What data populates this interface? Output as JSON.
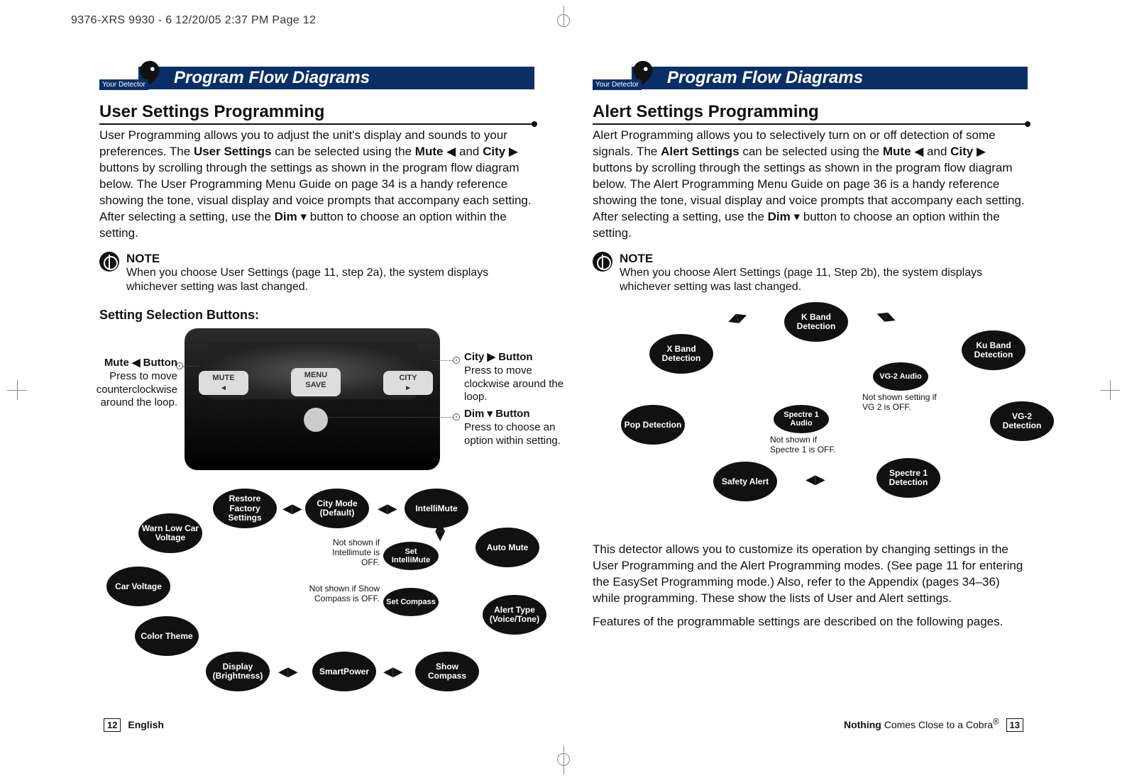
{
  "slug": "9376-XRS 9930 - 6  12/20/05  2:37 PM  Page 12",
  "header": {
    "badge_text": "Your Detector",
    "title": "Program Flow Diagrams"
  },
  "left": {
    "section_title": "User Settings Programming",
    "intro_html": "User Programming allows you to adjust the unit's display and sounds to your preferences. The <b>User Settings</b> can be selected using the <b>Mute</b> ◀ and <b>City</b> ▶ buttons by scrolling through the settings as shown in the program flow diagram below. The User Programming Menu Guide on page 34 is a handy reference showing the tone, visual display and voice prompts that accompany each setting. After selecting a setting, use the <b>Dim</b> ▾ button to choose an option within the setting.",
    "note_head": "NOTE",
    "note_body": "When you choose User Settings (page 11, step 2a), the system displays whichever setting was last changed.",
    "subhead": "Setting Selection Buttons:",
    "device_labels": {
      "mute": "MUTE",
      "menu": "MENU\nSAVE",
      "city": "CITY"
    },
    "callouts": {
      "mute": {
        "title": "Mute ◀ Button",
        "body": "Press to move counterclockwise around the loop."
      },
      "city": {
        "title": "City ▶ Button",
        "body": "Press to move clockwise around the loop."
      },
      "dim": {
        "title": "Dim ▾ Button",
        "body": "Press to choose an option within setting."
      }
    },
    "loop_nodes": [
      "City Mode (Default)",
      "IntelliMute",
      "Auto Mute",
      "Alert Type (Voice/Tone)",
      "Show Compass",
      "SmartPower",
      "Display (Brightness)",
      "Color Theme",
      "Car Voltage",
      "Warn Low Car Voltage",
      "Restore Factory Settings"
    ],
    "loop_side_nodes": [
      "Set IntelliMute",
      "Set Compass"
    ],
    "loop_hints": {
      "intellimute": "Not shown if Intellimute is OFF.",
      "compass": "Not shown if Show Compass is OFF."
    },
    "footer_page": "12",
    "footer_text": "English"
  },
  "right": {
    "section_title": "Alert Settings Programming",
    "intro_html": "Alert Programming allows you to selectively turn on or off detection of some signals. The <b>Alert Settings</b> can be selected using the <b>Mute</b> ◀ and <b>City</b> ▶ buttons by scrolling through the settings as shown in the program flow diagram below. The Alert Programming Menu Guide on page 36 is a handy reference showing the tone, visual display and voice prompts that accompany each setting. After selecting a setting, use the <b>Dim</b> ▾ button to choose an option within the setting.",
    "note_head": "NOTE",
    "note_body": "When you choose Alert Settings (page 11, Step 2b), the system displays whichever setting was last changed.",
    "loop_nodes": [
      "K Band Detection",
      "Ku Band Detection",
      "VG-2 Detection",
      "Spectre 1 Detection",
      "Safety Alert",
      "Pop Detection",
      "X Band Detection"
    ],
    "loop_side_nodes": [
      "VG-2 Audio",
      "Spectre 1 Audio"
    ],
    "loop_hints": {
      "vg2": "Not shown setting if VG 2 is OFF.",
      "spectre": "Not shown if Spectre 1 is OFF."
    },
    "para1": "This detector allows you to customize its operation by changing settings in the User Programming and the Alert Programming modes. (See page 11 for entering the EasySet Programming mode.) Also, refer to the Appendix (pages 34–36) while programming. These show the lists of User and Alert settings.",
    "para2": "Features of the programmable settings are described on the following pages.",
    "footer_text_html": "<b>Nothing</b> Comes Close to a Cobra<sup>®</sup>",
    "footer_page": "13"
  }
}
